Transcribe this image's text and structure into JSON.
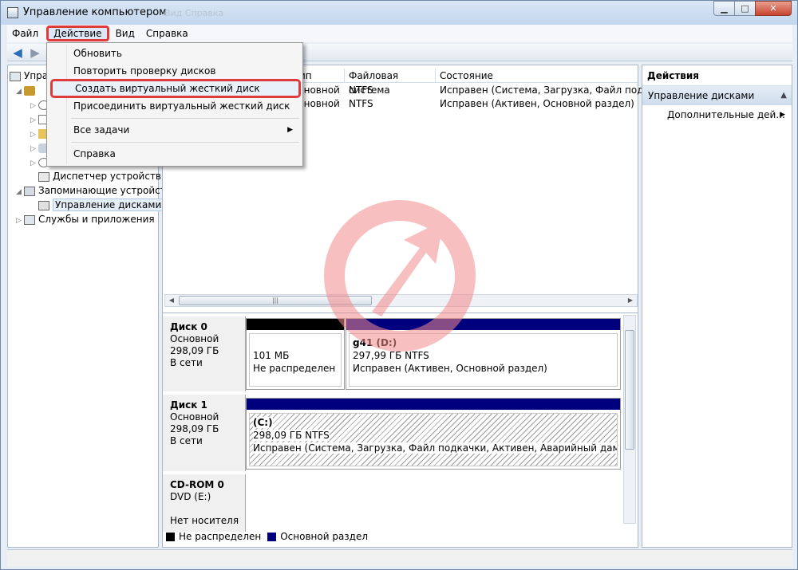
{
  "window": {
    "title": "Управление компьютером",
    "ghost_menu": "Вид   Справка"
  },
  "menubar": [
    "Файл",
    "Действие",
    "Вид",
    "Справка"
  ],
  "tree": [
    {
      "label": "Упра",
      "level": 0
    },
    {
      "label": "Диспетчер устройств",
      "level": 2
    },
    {
      "label": "Запоминающие устройст",
      "level": 1
    },
    {
      "label": "Управление дисками",
      "level": 2
    },
    {
      "label": "Службы и приложения",
      "level": 1
    }
  ],
  "columns": [
    "ип",
    "Файловая система",
    "Состояние"
  ],
  "volumes": [
    {
      "type": "сновной",
      "fs": "NTFS",
      "status": "Исправен (Система, Загрузка, Файл подкачк"
    },
    {
      "type": "сновной",
      "fs": "NTFS",
      "status": "Исправен (Активен, Основной раздел)"
    }
  ],
  "disks": [
    {
      "name": "Диск 0",
      "kind": "Основной",
      "size": "298,09 ГБ",
      "state": "В сети",
      "partitions": [
        {
          "line1": "",
          "line2": "101 МБ",
          "line3": "Не распределен",
          "color": "#000000"
        },
        {
          "line1": "g41  (D:)",
          "line2": "297,99 ГБ NTFS",
          "line3": "Исправен (Активен, Основной раздел)",
          "color": "#00007f"
        }
      ]
    },
    {
      "name": "Диск 1",
      "kind": "Основной",
      "size": "298,09 ГБ",
      "state": "В сети",
      "partitions": [
        {
          "line1": "(C:)",
          "line2": "298,09 ГБ NTFS",
          "line3": "Исправен (Система, Загрузка, Файл подкачки, Активен, Аварийный дамп памяти, Ч",
          "color": "#00007f"
        }
      ]
    },
    {
      "name": "CD-ROM 0",
      "kind": "DVD (E:)",
      "size": "",
      "state": "Нет носителя"
    }
  ],
  "legend": [
    {
      "label": "Не распределен",
      "color": "#000000"
    },
    {
      "label": "Основной раздел",
      "color": "#00007f"
    }
  ],
  "actions": {
    "header": "Действия",
    "section": "Управление дисками",
    "more": "Дополнительные дей..."
  },
  "context_menu": [
    "Обновить",
    "Повторить проверку дисков",
    "Создать виртуальный жесткий диск",
    "Присоединить виртуальный жесткий диск",
    "Все задачи",
    "Справка"
  ],
  "colors": {
    "highlight": "#e03b3b",
    "primary_partition": "#00007f",
    "unallocated": "#000000"
  }
}
